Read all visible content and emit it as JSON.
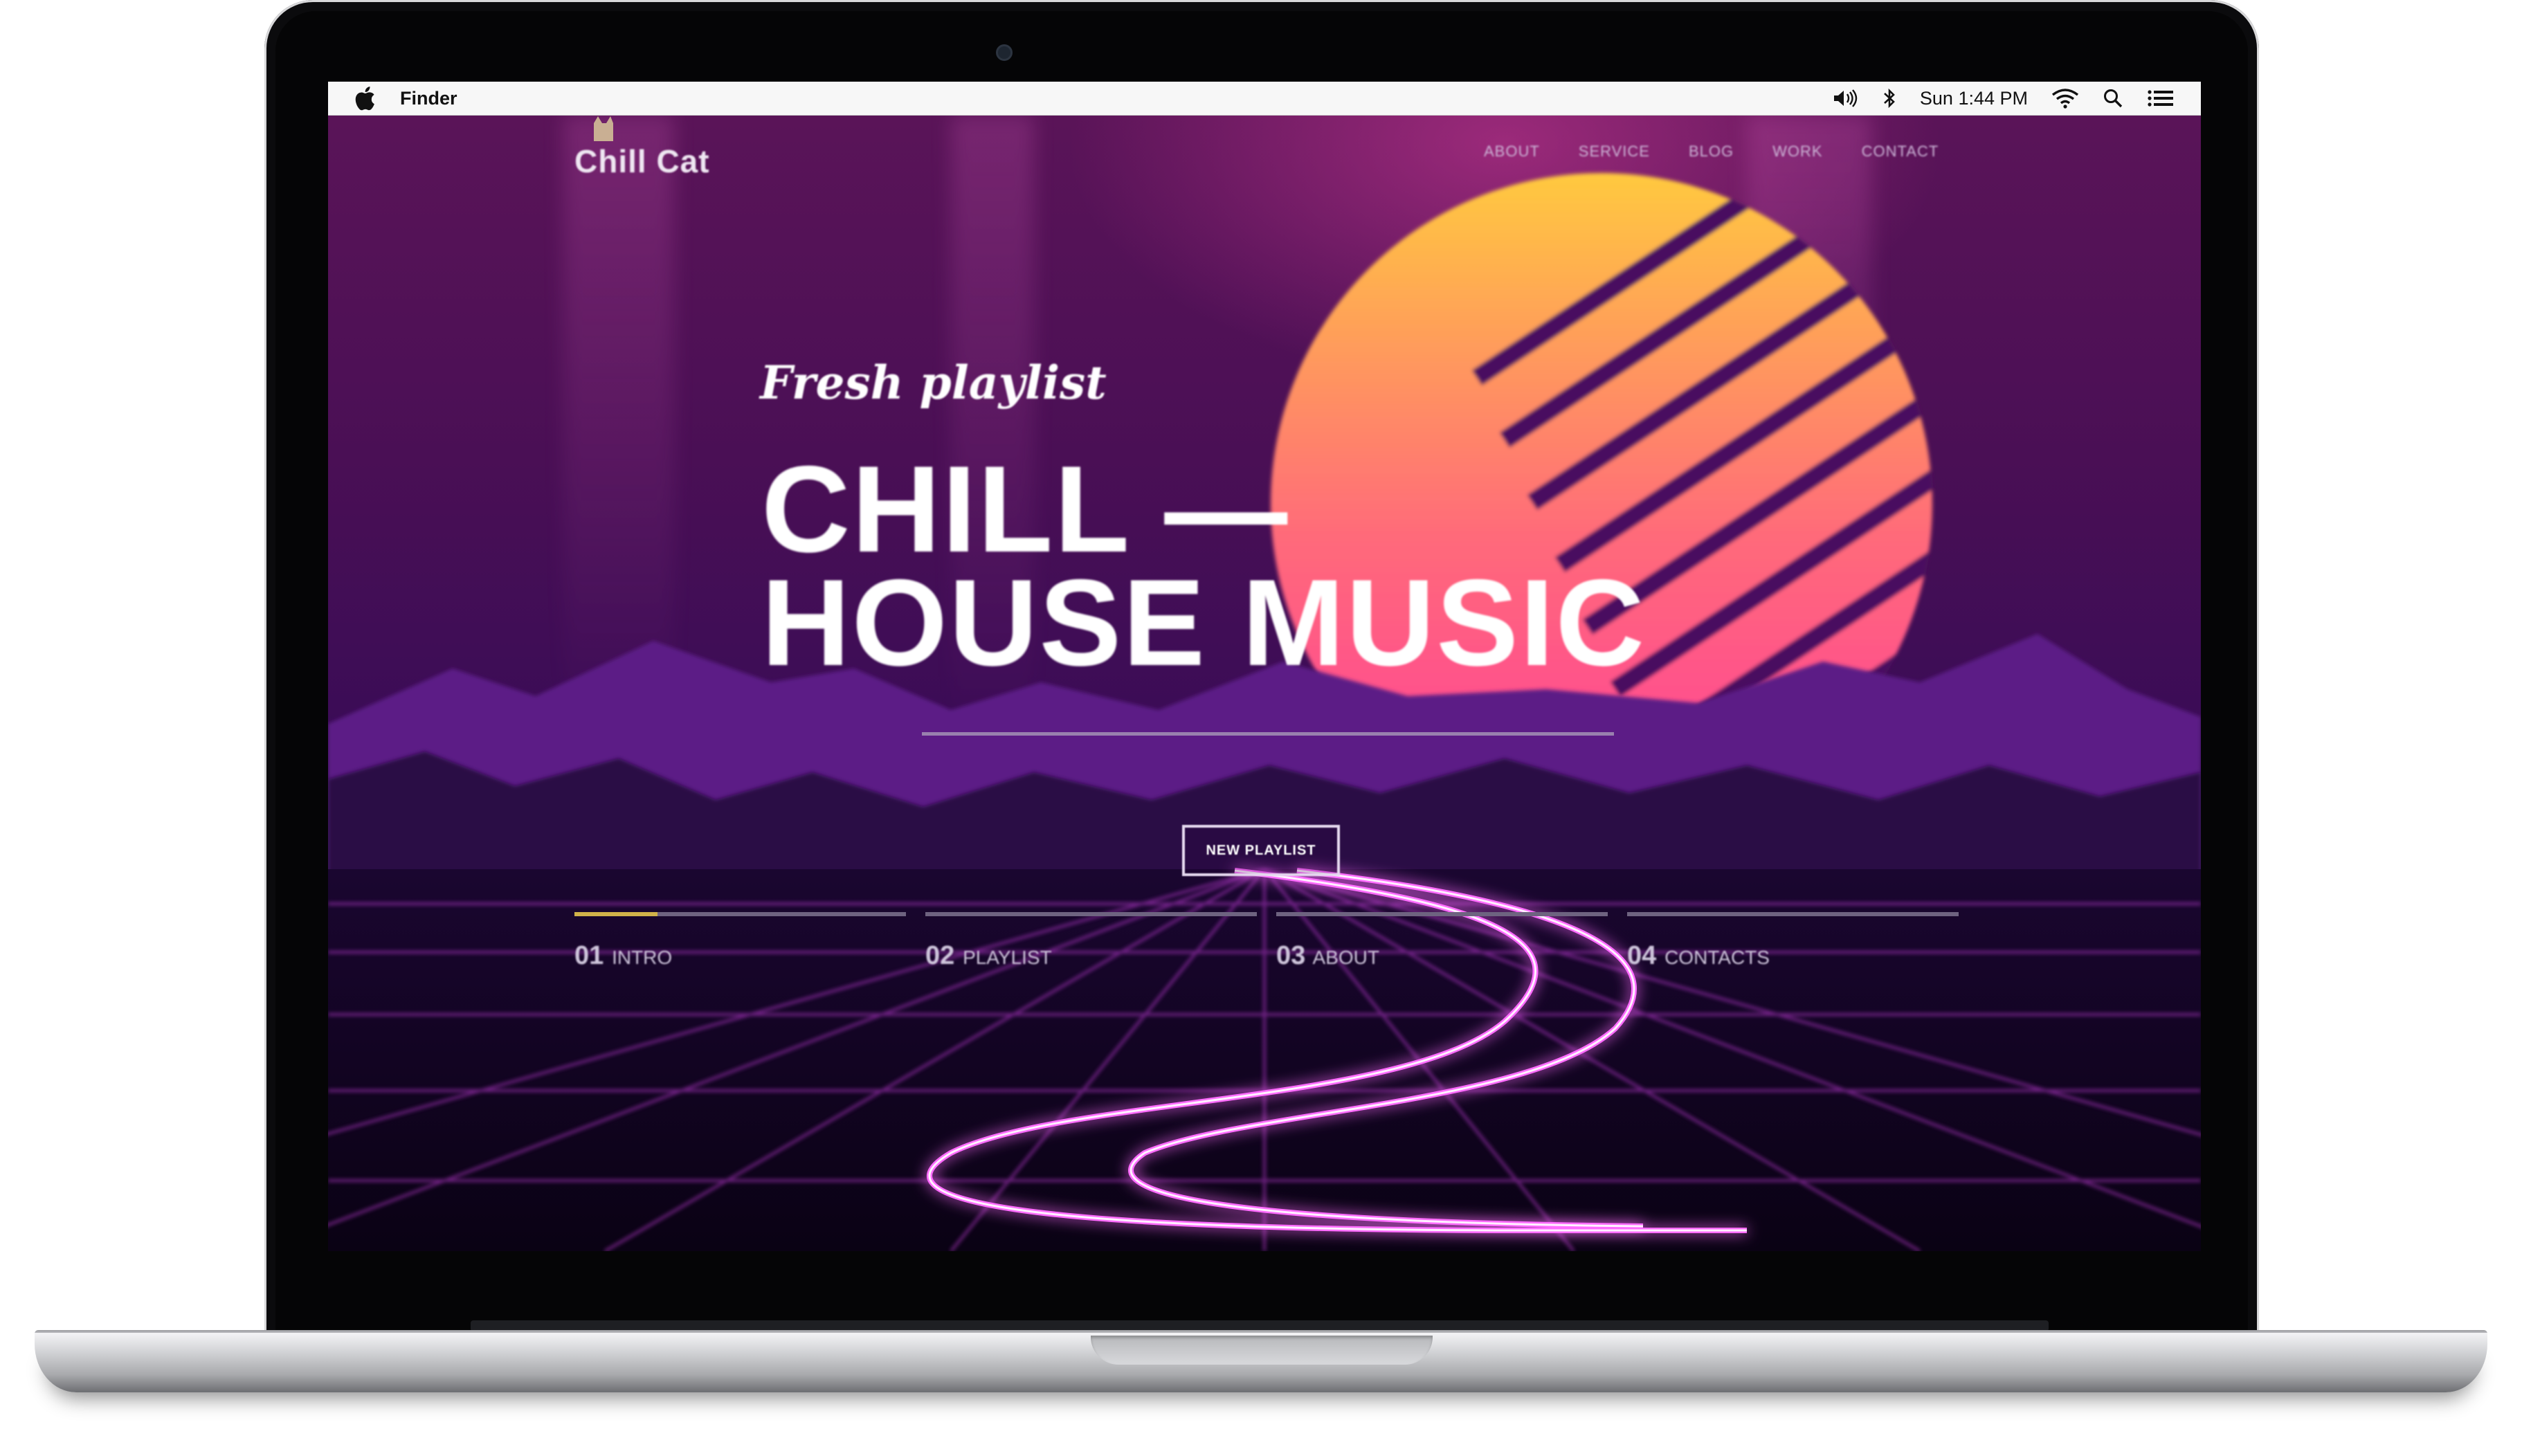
{
  "menubar": {
    "app_name": "Finder",
    "clock": "Sun 1:44 PM",
    "status_icons": [
      "apple-icon",
      "volume-icon",
      "bluetooth-icon",
      "wifi-icon",
      "search-icon",
      "notification-center-icon"
    ]
  },
  "site": {
    "logo_text": "Chill Cat",
    "nav": [
      "ABOUT",
      "SERVICE",
      "BLOG",
      "WORK",
      "CONTACT"
    ],
    "tagline": "Fresh playlist",
    "headline_line1": "CHILL —",
    "headline_line2": "HOUSE MUSIC",
    "cta_label": "NEW PLAYLIST",
    "steps": [
      {
        "num": "01",
        "label": "INTRO",
        "progress": 0.25
      },
      {
        "num": "02",
        "label": "PLAYLIST",
        "progress": 0
      },
      {
        "num": "03",
        "label": "ABOUT",
        "progress": 0
      },
      {
        "num": "04",
        "label": "CONTACTS",
        "progress": 0
      }
    ],
    "colors": {
      "sun_top": "#ffc93f",
      "sun_bottom": "#ff3d9a",
      "grid_line": "#c03bd6",
      "road_glow": "#ff6cff",
      "mountains_front": "#2a0a45",
      "progress_fill": "#d0b24a"
    }
  }
}
